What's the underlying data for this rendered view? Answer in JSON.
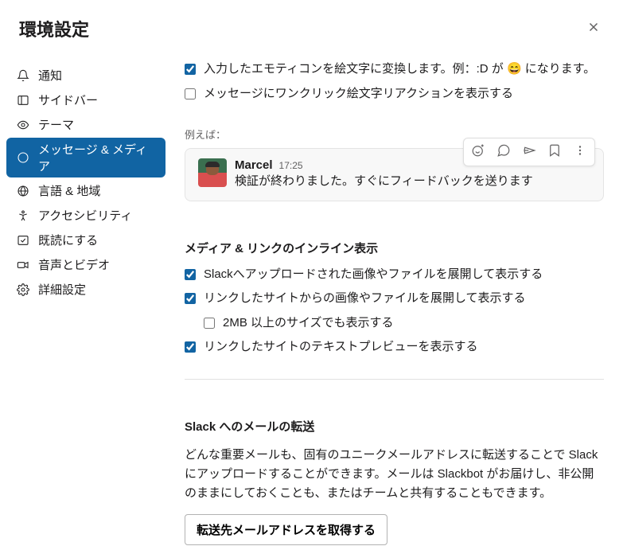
{
  "header": {
    "title": "環境設定"
  },
  "sidebar": {
    "items": [
      {
        "label": "通知"
      },
      {
        "label": "サイドバー"
      },
      {
        "label": "テーマ"
      },
      {
        "label": "メッセージ & メディア"
      },
      {
        "label": "言語 & 地域"
      },
      {
        "label": "アクセシビリティ"
      },
      {
        "label": "既読にする"
      },
      {
        "label": "音声とビデオ"
      },
      {
        "label": "詳細設定"
      }
    ]
  },
  "emoticon": {
    "convert_emoticons_prefix": "入力したエモティコンを絵文字に変換します。例：:D が ",
    "convert_emoticons_suffix": " になります。",
    "convert_emoticons_emoji": "😄",
    "show_one_click": "メッセージにワンクリック絵文字リアクションを表示する",
    "example_label": "例えば："
  },
  "message": {
    "author": "Marcel",
    "time": "17:25",
    "text": "検証が終わりました。すぐにフィードバックを送ります"
  },
  "media": {
    "title": "メディア & リンクのインライン表示",
    "expand_uploaded": "Slackへアップロードされた画像やファイルを展開して表示する",
    "expand_linked": "リンクしたサイトからの画像やファイルを展開して表示する",
    "even_large": "2MB 以上のサイズでも表示する",
    "show_preview": "リンクしたサイトのテキストプレビューを表示する"
  },
  "email": {
    "title": "Slack へのメールの転送",
    "desc": "どんな重要メールも、固有のユニークメールアドレスに転送することで Slack にアップロードすることができます。メールは Slackbot がお届けし、非公開のままにしておくことも、またはチームと共有することもできます。",
    "button": "転送先メールアドレスを取得する"
  }
}
